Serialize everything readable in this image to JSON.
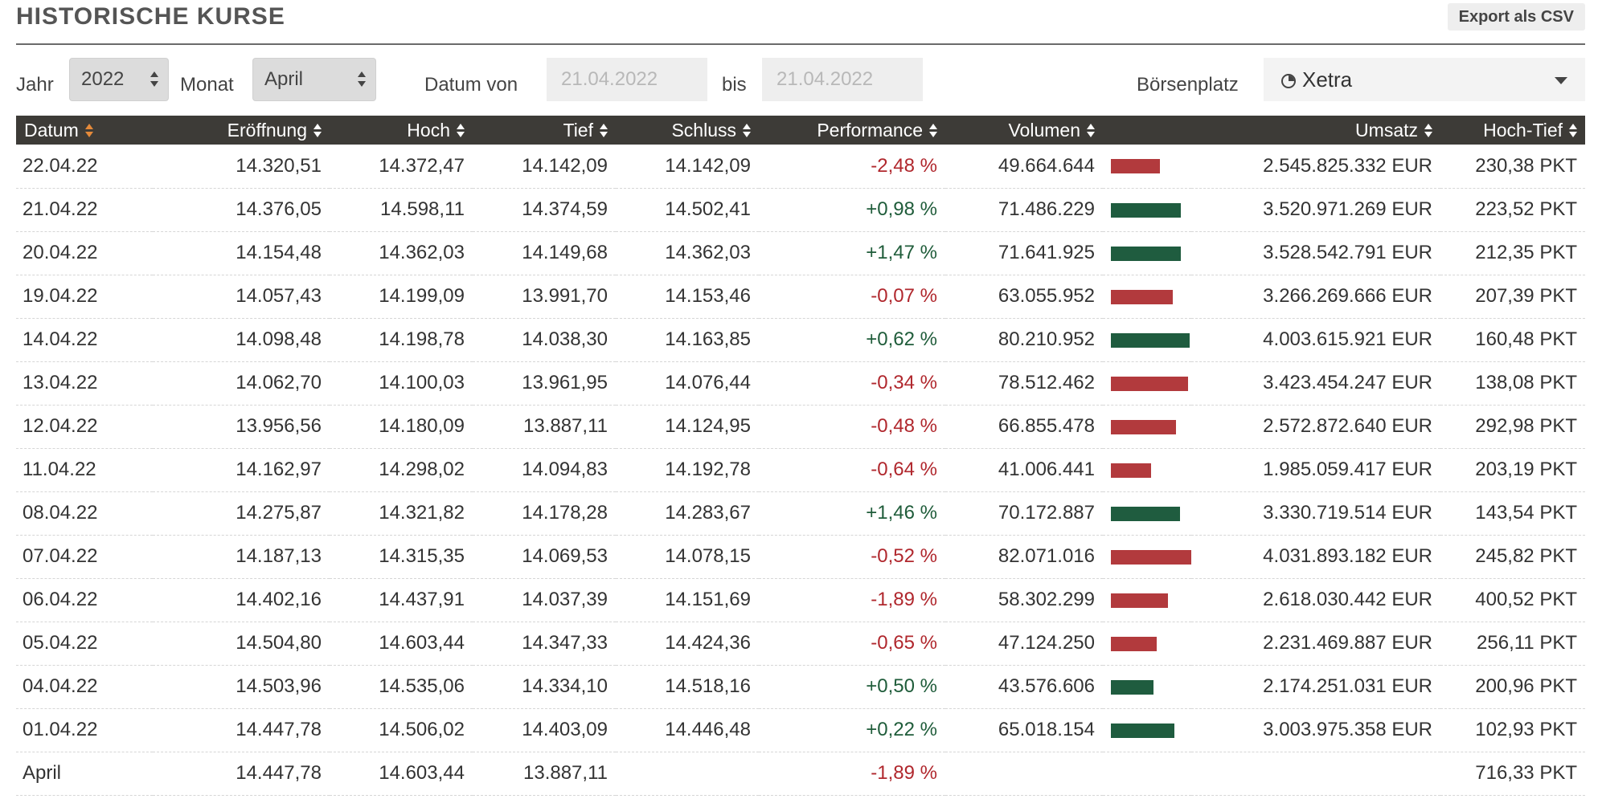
{
  "header": {
    "title": "HISTORISCHE KURSE",
    "export_label": "Export als CSV"
  },
  "filters": {
    "year_label": "Jahr",
    "year_value": "2022",
    "month_label": "Monat",
    "month_value": "April",
    "date_from_label": "Datum von",
    "date_from_value": "21.04.2022",
    "date_to_label": "bis",
    "date_to_value": "21.04.2022",
    "exchange_label": "Börsenplatz",
    "exchange_value": "Xetra",
    "exchange_icon": "clock-icon"
  },
  "table": {
    "columns": [
      "Datum",
      "Eröffnung",
      "Hoch",
      "Tief",
      "Schluss",
      "Performance",
      "Volumen",
      "Umsatz",
      "Hoch-Tief"
    ],
    "sorted_column": "Datum",
    "rows": [
      {
        "date": "22.04.22",
        "open": "14.320,51",
        "high": "14.372,47",
        "low": "14.142,09",
        "close": "14.142,09",
        "perf": "-2,48 %",
        "dir": "neg",
        "volume": "49.664.644",
        "vol_num": 49664644,
        "turnover": "2.545.825.332 EUR",
        "range": "230,38 PKT"
      },
      {
        "date": "21.04.22",
        "open": "14.376,05",
        "high": "14.598,11",
        "low": "14.374,59",
        "close": "14.502,41",
        "perf": "+0,98 %",
        "dir": "pos",
        "volume": "71.486.229",
        "vol_num": 71486229,
        "turnover": "3.520.971.269 EUR",
        "range": "223,52 PKT"
      },
      {
        "date": "20.04.22",
        "open": "14.154,48",
        "high": "14.362,03",
        "low": "14.149,68",
        "close": "14.362,03",
        "perf": "+1,47 %",
        "dir": "pos",
        "volume": "71.641.925",
        "vol_num": 71641925,
        "turnover": "3.528.542.791 EUR",
        "range": "212,35 PKT"
      },
      {
        "date": "19.04.22",
        "open": "14.057,43",
        "high": "14.199,09",
        "low": "13.991,70",
        "close": "14.153,46",
        "perf": "-0,07 %",
        "dir": "neg",
        "volume": "63.055.952",
        "vol_num": 63055952,
        "turnover": "3.266.269.666 EUR",
        "range": "207,39 PKT"
      },
      {
        "date": "14.04.22",
        "open": "14.098,48",
        "high": "14.198,78",
        "low": "14.038,30",
        "close": "14.163,85",
        "perf": "+0,62 %",
        "dir": "pos",
        "volume": "80.210.952",
        "vol_num": 80210952,
        "turnover": "4.003.615.921 EUR",
        "range": "160,48 PKT"
      },
      {
        "date": "13.04.22",
        "open": "14.062,70",
        "high": "14.100,03",
        "low": "13.961,95",
        "close": "14.076,44",
        "perf": "-0,34 %",
        "dir": "neg",
        "volume": "78.512.462",
        "vol_num": 78512462,
        "turnover": "3.423.454.247 EUR",
        "range": "138,08 PKT"
      },
      {
        "date": "12.04.22",
        "open": "13.956,56",
        "high": "14.180,09",
        "low": "13.887,11",
        "close": "14.124,95",
        "perf": "-0,48 %",
        "dir": "neg",
        "volume": "66.855.478",
        "vol_num": 66855478,
        "turnover": "2.572.872.640 EUR",
        "range": "292,98 PKT"
      },
      {
        "date": "11.04.22",
        "open": "14.162,97",
        "high": "14.298,02",
        "low": "14.094,83",
        "close": "14.192,78",
        "perf": "-0,64 %",
        "dir": "neg",
        "volume": "41.006.441",
        "vol_num": 41006441,
        "turnover": "1.985.059.417 EUR",
        "range": "203,19 PKT"
      },
      {
        "date": "08.04.22",
        "open": "14.275,87",
        "high": "14.321,82",
        "low": "14.178,28",
        "close": "14.283,67",
        "perf": "+1,46 %",
        "dir": "pos",
        "volume": "70.172.887",
        "vol_num": 70172887,
        "turnover": "3.330.719.514 EUR",
        "range": "143,54 PKT"
      },
      {
        "date": "07.04.22",
        "open": "14.187,13",
        "high": "14.315,35",
        "low": "14.069,53",
        "close": "14.078,15",
        "perf": "-0,52 %",
        "dir": "neg",
        "volume": "82.071.016",
        "vol_num": 82071016,
        "turnover": "4.031.893.182 EUR",
        "range": "245,82 PKT"
      },
      {
        "date": "06.04.22",
        "open": "14.402,16",
        "high": "14.437,91",
        "low": "14.037,39",
        "close": "14.151,69",
        "perf": "-1,89 %",
        "dir": "neg",
        "volume": "58.302.299",
        "vol_num": 58302299,
        "turnover": "2.618.030.442 EUR",
        "range": "400,52 PKT"
      },
      {
        "date": "05.04.22",
        "open": "14.504,80",
        "high": "14.603,44",
        "low": "14.347,33",
        "close": "14.424,36",
        "perf": "-0,65 %",
        "dir": "neg",
        "volume": "47.124.250",
        "vol_num": 47124250,
        "turnover": "2.231.469.887 EUR",
        "range": "256,11 PKT"
      },
      {
        "date": "04.04.22",
        "open": "14.503,96",
        "high": "14.535,06",
        "low": "14.334,10",
        "close": "14.518,16",
        "perf": "+0,50 %",
        "dir": "pos",
        "volume": "43.576.606",
        "vol_num": 43576606,
        "turnover": "2.174.251.031 EUR",
        "range": "200,96 PKT"
      },
      {
        "date": "01.04.22",
        "open": "14.447,78",
        "high": "14.506,02",
        "low": "14.403,09",
        "close": "14.446,48",
        "perf": "+0,22 %",
        "dir": "pos",
        "volume": "65.018.154",
        "vol_num": 65018154,
        "turnover": "3.003.975.358 EUR",
        "range": "102,93 PKT"
      }
    ],
    "summary": {
      "label": "April",
      "open": "14.447,78",
      "high": "14.603,44",
      "low": "13.887,11",
      "close": "",
      "perf": "-1,89 %",
      "dir": "neg",
      "volume": "",
      "turnover": "",
      "range": "716,33 PKT"
    }
  },
  "colors": {
    "negative": "#b0272d",
    "positive": "#1f5c3a",
    "header_bg": "#3d3b37",
    "sort_active": "#e58a3a"
  }
}
